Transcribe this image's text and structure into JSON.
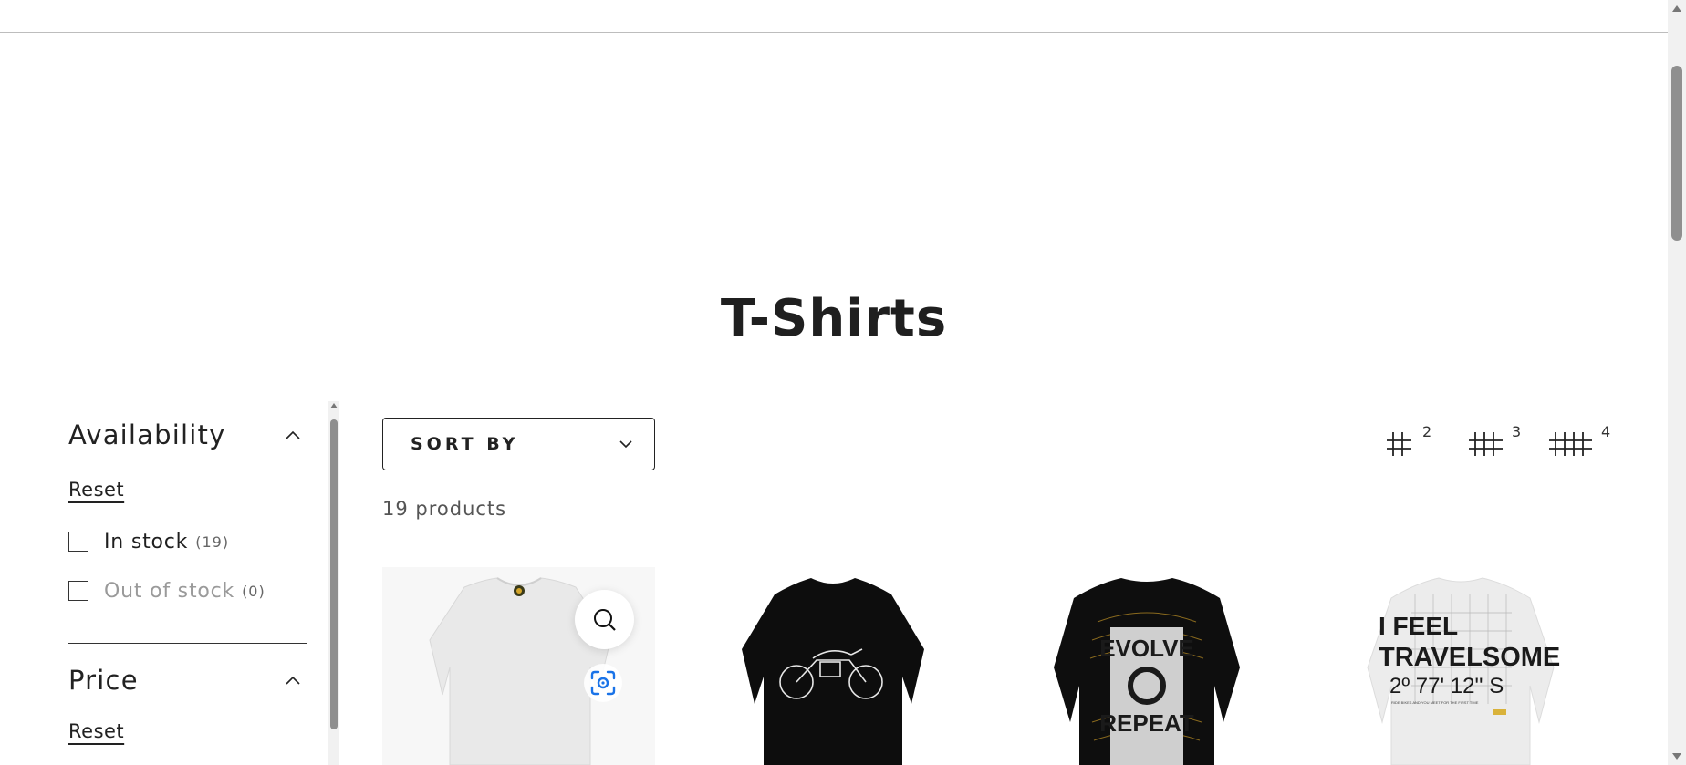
{
  "collection": {
    "title": "T-Shirts"
  },
  "filters": {
    "availability": {
      "title": "Availability",
      "reset_label": "Reset",
      "options": [
        {
          "label": "In stock",
          "count": "(19)"
        },
        {
          "label": "Out of stock",
          "count": "(0)"
        }
      ]
    },
    "price": {
      "title": "Price",
      "reset_label": "Reset"
    }
  },
  "toolbar": {
    "sort_label": "SORT BY",
    "product_count": "19 products",
    "grid_options": [
      "2",
      "3",
      "4"
    ]
  },
  "products": [
    {
      "color": "white",
      "graphic": "small chest logo"
    },
    {
      "color": "black",
      "graphic": "motorcycle line art"
    },
    {
      "color": "black",
      "graphic": "EVOLVE REPEAT"
    },
    {
      "color": "white",
      "graphic": "I FEEL TRAVELSOME"
    }
  ],
  "product_graphics": {
    "evolve_top": "EVOLVE",
    "evolve_bottom": "REPEAT",
    "travel_line1": "I FEEL",
    "travel_line2": "TRAVELSOME",
    "travel_coords": "2º 77' 12'' S",
    "travel_small": "RIDE BIKES AND YOU MEET FOR THE FIRST TIME"
  },
  "colors": {
    "text": "#1f1f1f",
    "lens_icon": "#1a73e8",
    "divider": "#333333"
  },
  "icons": [
    "chevron-up-icon",
    "chevron-down-icon",
    "search-icon",
    "google-lens-icon",
    "grid-2-icon",
    "grid-3-icon",
    "grid-4-icon"
  ]
}
